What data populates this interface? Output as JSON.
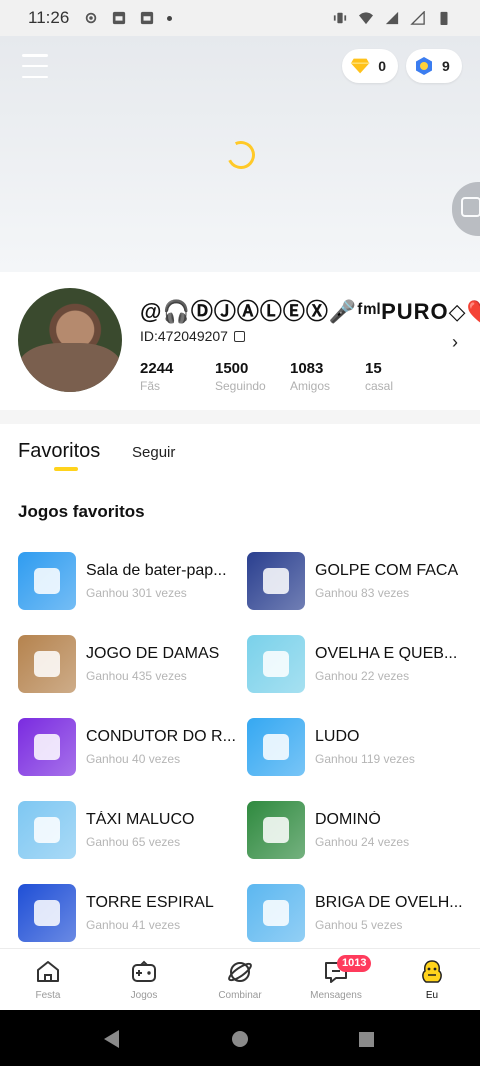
{
  "status_bar": {
    "time": "11:26"
  },
  "wallet": {
    "diamonds": "0",
    "coins": "9"
  },
  "profile": {
    "username": "@🎧ⒹⒿⒶⓁⒺⓍ🎤ᶠᵐˡPURO◇❤️",
    "id": "ID:472049207",
    "stats": [
      {
        "value": "2244",
        "label": "Fãs"
      },
      {
        "value": "1500",
        "label": "Seguindo"
      },
      {
        "value": "1083",
        "label": "Amigos"
      },
      {
        "value": "15",
        "label": "casal"
      }
    ]
  },
  "tabs": {
    "favorites": "Favoritos",
    "follow": "Seguir"
  },
  "section_title": "Jogos favoritos",
  "games": [
    {
      "name": "Sala de bater-pap...",
      "wins": "Ganhou 301 vezes",
      "color": "#2f9cf0",
      "icon": "dice-chat-icon"
    },
    {
      "name": "GOLPE COM FACA",
      "wins": "Ganhou 83 vezes",
      "color": "#2a3f8f",
      "icon": "knife-icon"
    },
    {
      "name": "JOGO DE DAMAS",
      "wins": "Ganhou 435 vezes",
      "color": "#b5834e",
      "icon": "checkers-icon"
    },
    {
      "name": "OVELHA E QUEB...",
      "wins": "Ganhou 22 vezes",
      "color": "#7ad1ea",
      "icon": "sheep-puzzle-icon"
    },
    {
      "name": "CONDUTOR DO R...",
      "wins": "Ganhou 40 vezes",
      "color": "#7a2be0",
      "icon": "race-car-icon"
    },
    {
      "name": "LUDO",
      "wins": "Ganhou 119 vezes",
      "color": "#35a8f2",
      "icon": "ludo-dice-icon"
    },
    {
      "name": "TÁXI MALUCO",
      "wins": "Ganhou 65 vezes",
      "color": "#7ec7f2",
      "icon": "taxi-icon"
    },
    {
      "name": "DOMINÓ",
      "wins": "Ganhou 24 vezes",
      "color": "#2f8a3f",
      "icon": "domino-icon"
    },
    {
      "name": "TORRE ESPIRAL",
      "wins": "Ganhou 41 vezes",
      "color": "#1f4fd6",
      "icon": "spiral-tower-icon"
    },
    {
      "name": "BRIGA DE OVELH...",
      "wins": "Ganhou 5 vezes",
      "color": "#5cb7f0",
      "icon": "sheep-fight-icon"
    }
  ],
  "bottom_nav": [
    {
      "label": "Festa",
      "icon": "house-icon"
    },
    {
      "label": "Jogos",
      "icon": "gamepad-icon"
    },
    {
      "label": "Combinar",
      "icon": "planet-icon"
    },
    {
      "label": "Mensagens",
      "icon": "message-icon",
      "badge": "1013"
    },
    {
      "label": "Eu",
      "icon": "profile-icon"
    }
  ],
  "colors": {
    "accent": "#ffd31c",
    "badge": "#ff3b5c"
  }
}
